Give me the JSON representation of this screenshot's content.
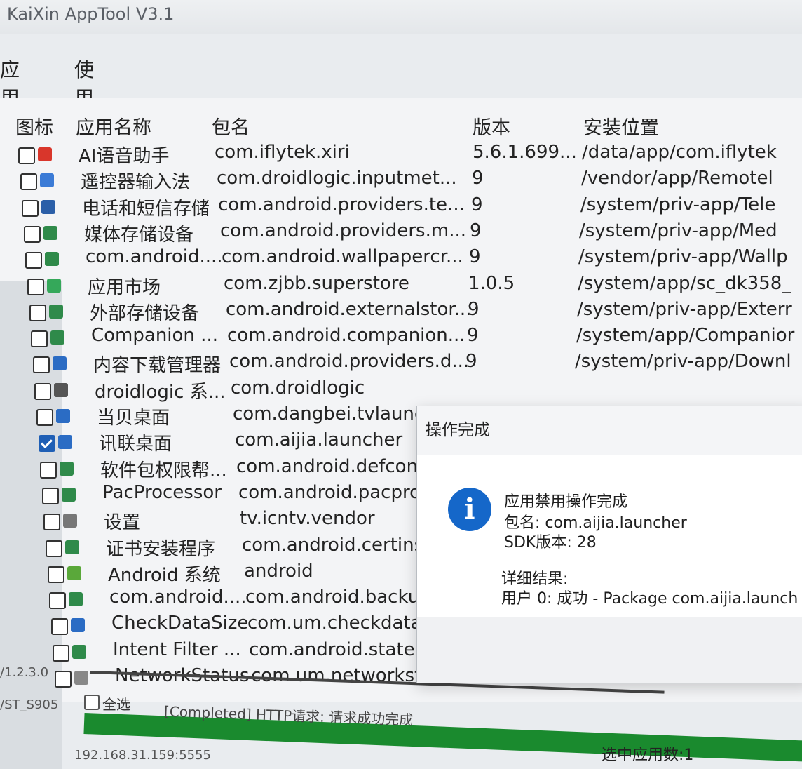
{
  "window": {
    "title": "KaiXin AppTool V3.1"
  },
  "menu": [
    "应用管理",
    "使用说明"
  ],
  "columns": {
    "icon": "图标",
    "name": "应用名称",
    "package": "包名",
    "version": "版本",
    "location": "安装位置"
  },
  "rows": [
    {
      "checked": false,
      "icon_color": "#d9362b",
      "name": "AI语音助手",
      "package": "com.iflytek.xiri",
      "version": "5.6.1.699...",
      "location": "/data/app/com.iflytek"
    },
    {
      "checked": false,
      "icon_color": "#3b7bd6",
      "name": "遥控器输入法",
      "package": "com.droidlogic.inputmet...",
      "version": "9",
      "location": "/vendor/app/Remotel"
    },
    {
      "checked": false,
      "icon_color": "#2b5fa8",
      "name": "电话和短信存储",
      "package": "com.android.providers.te...",
      "version": "9",
      "location": "/system/priv-app/Tele"
    },
    {
      "checked": false,
      "icon_color": "#2f8a4a",
      "name": "媒体存储设备",
      "package": "com.android.providers.m...",
      "version": "9",
      "location": "/system/priv-app/Med"
    },
    {
      "checked": false,
      "icon_color": "#2f8a4a",
      "name": "com.android....",
      "package": "com.android.wallpapercr...",
      "version": "9",
      "location": "/system/priv-app/Wallp"
    },
    {
      "checked": false,
      "icon_color": "#35a85a",
      "name": "应用市场",
      "package": "com.zjbb.superstore",
      "version": "1.0.5",
      "location": "/system/app/sc_dk358_"
    },
    {
      "checked": false,
      "icon_color": "#2f8a4a",
      "name": "外部存储设备",
      "package": "com.android.externalstor...",
      "version": "9",
      "location": "/system/priv-app/Exterr"
    },
    {
      "checked": false,
      "icon_color": "#2f8a4a",
      "name": "Companion ...",
      "package": "com.android.companion...",
      "version": "9",
      "location": "/system/app/Companior"
    },
    {
      "checked": false,
      "icon_color": "#2b6cc4",
      "name": "内容下载管理器",
      "package": "com.android.providers.d...",
      "version": "9",
      "location": "/system/priv-app/Downl"
    },
    {
      "checked": false,
      "icon_color": "#555555",
      "name": "droidlogic 系...",
      "package": "com.droidlogic",
      "version": "",
      "location": ""
    },
    {
      "checked": false,
      "icon_color": "#2b6cc4",
      "name": "当贝桌面",
      "package": "com.dangbei.tvlaunche",
      "version": "",
      "location": ""
    },
    {
      "checked": true,
      "icon_color": "#2b6cc4",
      "name": "讯联桌面",
      "package": "com.aijia.launcher",
      "version": "",
      "location": ""
    },
    {
      "checked": false,
      "icon_color": "#2f8a4a",
      "name": "软件包权限帮...",
      "package": "com.android.defcontai",
      "version": "",
      "location": ""
    },
    {
      "checked": false,
      "icon_color": "#2f8a4a",
      "name": "PacProcessor",
      "package": "com.android.pacproce",
      "version": "",
      "location": ""
    },
    {
      "checked": false,
      "icon_color": "#777777",
      "name": "设置",
      "package": "tv.icntv.vendor",
      "version": "",
      "location": ""
    },
    {
      "checked": false,
      "icon_color": "#2f8a4a",
      "name": "证书安装程序",
      "package": "com.android.certinstal",
      "version": "",
      "location": ""
    },
    {
      "checked": false,
      "icon_color": "#5aa83a",
      "name": "Android 系统",
      "package": "android",
      "version": "",
      "location": ""
    },
    {
      "checked": false,
      "icon_color": "#2f8a4a",
      "name": "com.android....",
      "package": "com.android.backupcc",
      "version": "",
      "location": ""
    },
    {
      "checked": false,
      "icon_color": "#2b6cc4",
      "name": "CheckDataSize",
      "package": "com.um.checkdatasize",
      "version": "",
      "location": ""
    },
    {
      "checked": false,
      "icon_color": "#2f8a4a",
      "name": "Intent Filter ...",
      "package": "com.android.statemen",
      "version": "",
      "location": ""
    },
    {
      "checked": false,
      "icon_color": "#888888",
      "name": "NetworkStatus",
      "package": "com.um.networkstatus",
      "version": "",
      "location": ""
    }
  ],
  "dialog": {
    "title": "操作完成",
    "line1": "应用禁用操作完成",
    "line2": "包名: com.aijia.launcher",
    "line3": "SDK版本: 28",
    "line4": "详细结果:",
    "line5": "用户 0: 成功 - Package com.aijia.launch"
  },
  "footer": {
    "version": "/1.2.3.0",
    "device": "/ST_S905",
    "select_all": "全选",
    "status": "[Completed] HTTP请求: 请求成功完成",
    "progress_fraction": 1.0,
    "ip": "192.168.31.159:5555",
    "selected_count": "选中应用数:1"
  },
  "colors": {
    "accent": "#1567c9",
    "progress": "#1a8a2e"
  }
}
